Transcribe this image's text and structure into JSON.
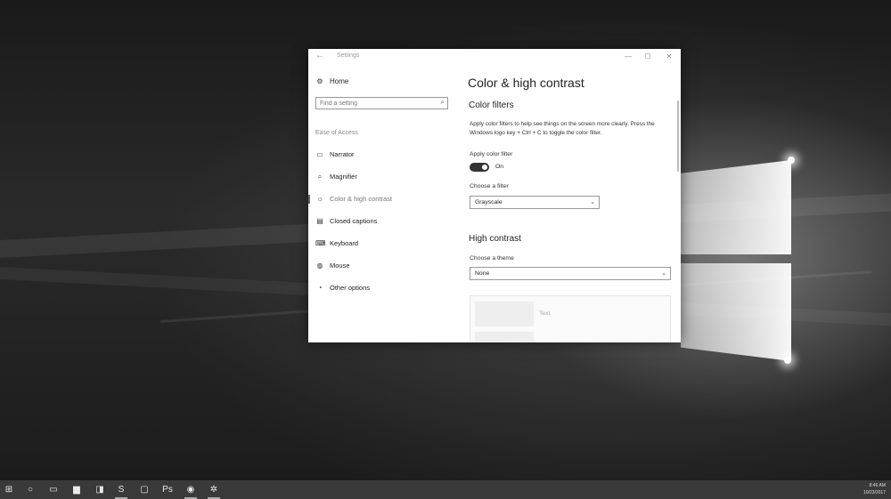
{
  "window": {
    "title": "Settings",
    "back_icon": "arrow-left-icon",
    "controls": {
      "minimize": "—",
      "maximize": "☐",
      "close": "✕"
    }
  },
  "sidebar": {
    "home_label": "Home",
    "search_placeholder": "Find a setting",
    "section_label": "Ease of Access",
    "items": [
      {
        "label": "Narrator",
        "icon": "narrator-icon",
        "glyph": "▭",
        "active": false
      },
      {
        "label": "Magnifier",
        "icon": "magnifier-icon",
        "glyph": "⌕",
        "active": false
      },
      {
        "label": "Color & high contrast",
        "icon": "color-contrast-icon",
        "glyph": "☼",
        "active": true
      },
      {
        "label": "Closed captions",
        "icon": "closed-captions-icon",
        "glyph": "▤",
        "active": false
      },
      {
        "label": "Keyboard",
        "icon": "keyboard-icon",
        "glyph": "⌨",
        "active": false
      },
      {
        "label": "Mouse",
        "icon": "mouse-icon",
        "glyph": "◍",
        "active": false
      },
      {
        "label": "Other options",
        "icon": "other-options-icon",
        "glyph": "◔",
        "active": false
      }
    ]
  },
  "content": {
    "title": "Color & high contrast",
    "color_filters": {
      "heading": "Color filters",
      "description": "Apply color filters to help see things on the screen more clearly. Press the Windows logo key + Ctrl + C to toggle the color filter.",
      "apply_label": "Apply color filter",
      "toggle_state": "On",
      "choose_label": "Choose a filter",
      "filter_value": "Grayscale"
    },
    "high_contrast": {
      "heading": "High contrast",
      "choose_label": "Choose a theme",
      "theme_value": "None",
      "preview_text": "Text"
    }
  },
  "taskbar": {
    "icons": [
      {
        "name": "start-icon",
        "glyph": "⊞",
        "open": false
      },
      {
        "name": "cortana-icon",
        "glyph": "○",
        "open": false
      },
      {
        "name": "task-view-icon",
        "glyph": "▭",
        "open": false
      },
      {
        "name": "file-explorer-icon",
        "glyph": "▆",
        "open": false
      },
      {
        "name": "store-icon",
        "glyph": "◨",
        "open": false
      },
      {
        "name": "snagit-icon",
        "glyph": "S",
        "open": true
      },
      {
        "name": "window-app-icon",
        "glyph": "▢",
        "open": false
      },
      {
        "name": "photoshop-icon",
        "glyph": "Ps",
        "open": false
      },
      {
        "name": "chrome-icon",
        "glyph": "◉",
        "open": true
      },
      {
        "name": "settings-app-icon",
        "glyph": "✲",
        "open": true
      }
    ],
    "time": "8:46 AM",
    "date": "10/23/2017"
  }
}
